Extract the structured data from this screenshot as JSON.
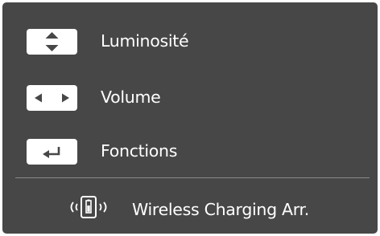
{
  "menu": {
    "items": [
      {
        "label": "Luminosité",
        "icon": "up-down-arrows-icon"
      },
      {
        "label": "Volume",
        "icon": "left-right-arrows-icon"
      },
      {
        "label": "Fonctions",
        "icon": "enter-return-icon"
      }
    ]
  },
  "footer": {
    "label": "Wireless Charging Arr.",
    "icon": "wireless-charging-icon"
  },
  "colors": {
    "panel_background": "#474747",
    "text": "#ffffff",
    "key_background": "#ffffff",
    "key_glyph": "#474747",
    "divider": "#8a8a8a"
  }
}
